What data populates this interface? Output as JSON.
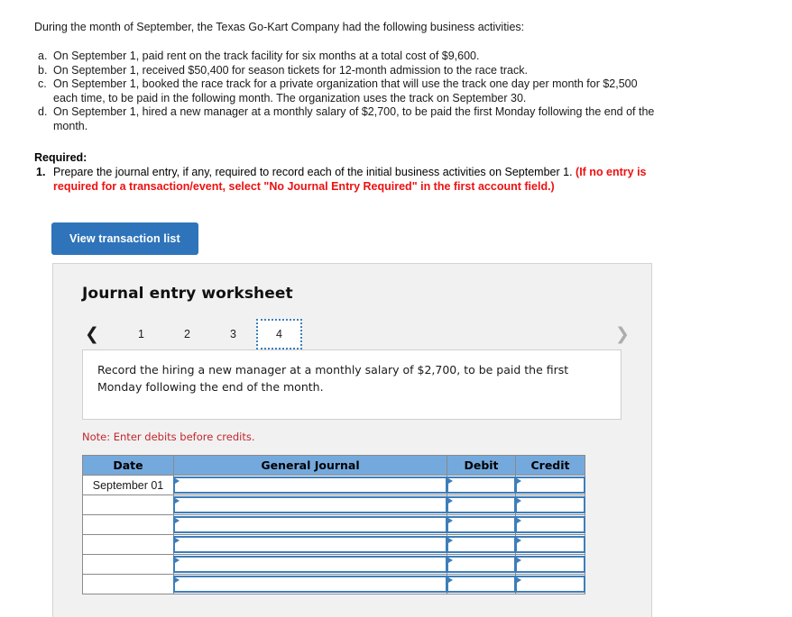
{
  "problem": {
    "intro": "During the month of September, the Texas Go-Kart Company had the following business activities:",
    "activities": [
      {
        "letter": "a.",
        "text": "On September 1, paid rent on the track facility for six months at a total cost of $9,600."
      },
      {
        "letter": "b.",
        "text": "On September 1, received $50,400 for season tickets for 12-month admission to the race track."
      },
      {
        "letter": "c.",
        "text": "On September 1, booked the race track for a private organization that will use the track one day per month for $2,500 each time, to be paid in the following month. The organization uses the track on September 30."
      },
      {
        "letter": "d.",
        "text": "On September 1, hired a new manager at a monthly salary of $2,700, to be paid the first Monday following the end of the month."
      }
    ]
  },
  "required": {
    "label": "Required:",
    "number": "1.",
    "text_black": "Prepare the journal entry, if any, required to record each of the initial business activities on September 1. ",
    "text_red": "(If no entry is required for a transaction/event, select \"No Journal Entry Required\" in the first account field.)"
  },
  "toolbar": {
    "view_transaction_list_label": "View transaction list"
  },
  "worksheet": {
    "title": "Journal entry worksheet",
    "pager": {
      "prev_icon": "chevron-left-icon",
      "next_icon": "chevron-right-icon",
      "tabs": [
        "1",
        "2",
        "3",
        "4"
      ],
      "active_tab": "4"
    },
    "instruction": "Record the hiring a new manager at a monthly salary of $2,700, to be paid the first Monday following the end of the month.",
    "note": "Note: Enter debits before credits.",
    "table": {
      "headers": [
        "Date",
        "General Journal",
        "Debit",
        "Credit"
      ],
      "rows": [
        {
          "date": "September 01",
          "general_journal": "",
          "debit": "",
          "credit": ""
        },
        {
          "date": "",
          "general_journal": "",
          "debit": "",
          "credit": ""
        },
        {
          "date": "",
          "general_journal": "",
          "debit": "",
          "credit": ""
        },
        {
          "date": "",
          "general_journal": "",
          "debit": "",
          "credit": ""
        },
        {
          "date": "",
          "general_journal": "",
          "debit": "",
          "credit": ""
        },
        {
          "date": "",
          "general_journal": "",
          "debit": "",
          "credit": ""
        }
      ]
    }
  },
  "colors": {
    "button_blue": "#2f74ba",
    "table_header_blue": "#74a9dd",
    "input_border_blue": "#3d7ebb",
    "note_red": "#c2272d",
    "required_red": "#ee1111",
    "panel_gray": "#f1f1f1"
  }
}
